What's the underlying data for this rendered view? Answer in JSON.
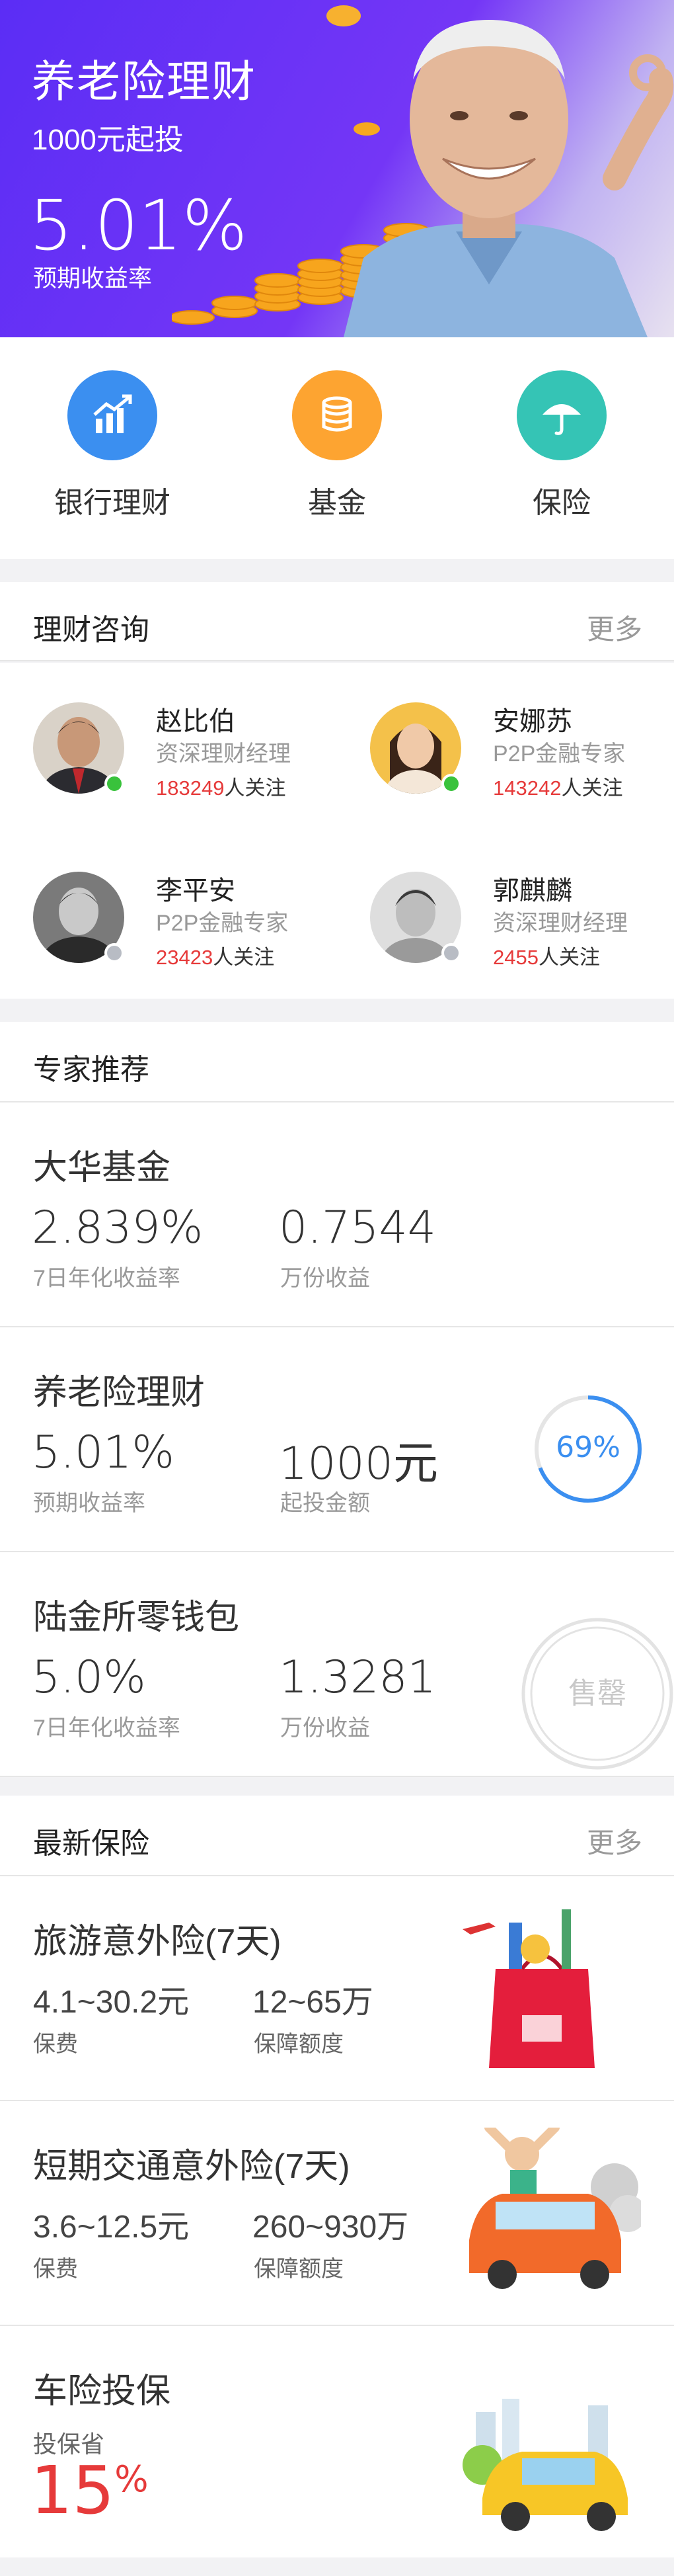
{
  "banner": {
    "title": "养老险理财",
    "subtitle": "1000元起投",
    "rate": "5.01%",
    "rate_label": "预期收益率"
  },
  "quick_menu": [
    {
      "label": "银行理财",
      "icon": "bar-chart-icon",
      "color": "#3b8ff0"
    },
    {
      "label": "基金",
      "icon": "coins-icon",
      "color": "#fda431"
    },
    {
      "label": "保险",
      "icon": "umbrella-icon",
      "color": "#35c4b5"
    }
  ],
  "consult": {
    "title": "理财咨询",
    "more": "更多",
    "follow_suffix": "人关注",
    "people": [
      {
        "name": "赵比伯",
        "title": "资深理财经理",
        "followers": "183249",
        "online": true
      },
      {
        "name": "安娜苏",
        "title": "P2P金融专家",
        "followers": "143242",
        "online": true
      },
      {
        "name": "李平安",
        "title": "P2P金融专家",
        "followers": "23423",
        "online": false
      },
      {
        "name": "郭麒麟",
        "title": "资深理财经理",
        "followers": "2455",
        "online": false
      }
    ]
  },
  "experts": {
    "title": "专家推荐",
    "products": [
      {
        "name": "大华基金",
        "v1": "2.839%",
        "l1": "7日年化收益率",
        "v2": "0.7544",
        "l2": "万份收益"
      },
      {
        "name": "养老险理财",
        "v1": "5.01%",
        "l1": "预期收益率",
        "v2": "1000元",
        "l2": "起投金额",
        "progress": "69%"
      },
      {
        "name": "陆金所零钱包",
        "v1": "5.0%",
        "l1": "7日年化收益率",
        "v2": "1.3281",
        "l2": "万份收益",
        "status": "售罄"
      }
    ]
  },
  "insurance": {
    "title": "最新保险",
    "more": "更多",
    "items": [
      {
        "name": "旅游意外险(7天)",
        "v1": "4.1~30.2元",
        "l1": "保费",
        "v2": "12~65万",
        "l2": "保障额度"
      },
      {
        "name": "短期交通意外险(7天)",
        "v1": "3.6~12.5元",
        "l1": "保费",
        "v2": "260~930万",
        "l2": "保障额度"
      },
      {
        "name": "车险投保",
        "sub": "投保省",
        "discount": "15",
        "unit": "%"
      }
    ]
  },
  "colors": {
    "accent": "#3b8ff0",
    "red": "#e63a3a",
    "online": "#39c23c",
    "offline": "#b8bcc4"
  }
}
